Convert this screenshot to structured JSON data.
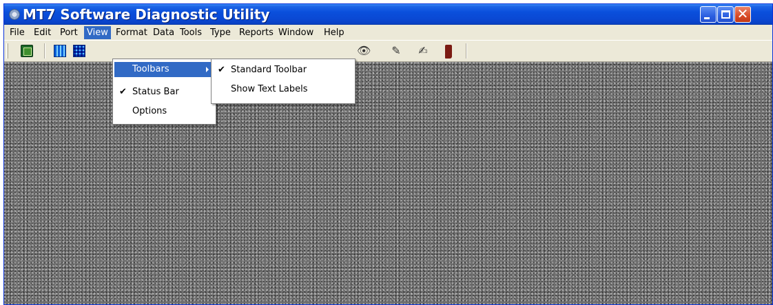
{
  "window": {
    "title": "MT7 Software Diagnostic Utility"
  },
  "menubar": {
    "items": [
      {
        "label": "File",
        "accel": "F"
      },
      {
        "label": "Edit"
      },
      {
        "label": "Port"
      },
      {
        "label": "View",
        "active": true
      },
      {
        "label": "Format"
      },
      {
        "label": "Data"
      },
      {
        "label": "Tools"
      },
      {
        "label": "Type"
      },
      {
        "label": "Reports"
      },
      {
        "label": "Window"
      },
      {
        "label": "Help"
      }
    ]
  },
  "view_menu": {
    "items": [
      {
        "label": "Toolbars",
        "submenu": true,
        "highlighted": true
      },
      {
        "label": "Status Bar",
        "checked": true
      },
      {
        "label": "Options"
      }
    ]
  },
  "toolbars_submenu": {
    "items": [
      {
        "label": "Standard Toolbar",
        "checked": true
      },
      {
        "label": "Show Text Labels"
      }
    ]
  },
  "toolbar": {
    "icons": [
      "book-icon",
      "grid-icon",
      "grid-large-icon",
      "eye-icon",
      "pencil-icon",
      "pen-sign-icon",
      "boot-icon"
    ]
  },
  "colors": {
    "titlebar": "#0a4fdc",
    "highlight": "#316ac5",
    "chrome": "#ece9d8",
    "close_button": "#d84a26"
  }
}
